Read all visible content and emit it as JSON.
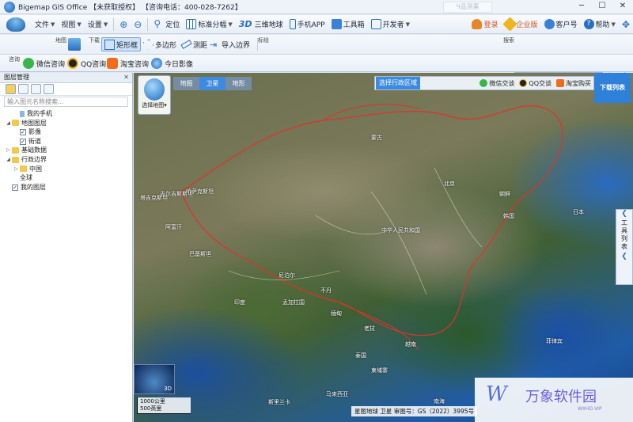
{
  "window": {
    "title": "Bigemap GIS Office 【未获取授权】 【咨询电话：400-028-7262】",
    "ghost_tab": "Ч品测素"
  },
  "menu": {
    "file": "文件",
    "view": "视图",
    "settings": "设置",
    "locate": "定位",
    "standard_split": "标准分幅",
    "three_d_label": "3D",
    "three_d_earth": "三维地球",
    "mobile_app": "手机APP",
    "toolbox": "工具箱",
    "developer": "开发者",
    "login": "登录",
    "enterprise": "企业版",
    "customer_id": "客户号",
    "help": "帮助"
  },
  "toolbar": {
    "map_label": "地图",
    "download_label": "下载",
    "rect_select": "矩形框",
    "polygon": "多边形",
    "measure": "测距",
    "import_border": "导入边界",
    "mark_label": "标绘",
    "search_label": "搜索",
    "consult_label": "咨询",
    "wechat_consult": "微信咨询",
    "qq_consult": "QQ咨询",
    "taobao_consult": "淘宝咨询",
    "today_image": "今日影像"
  },
  "sidebar": {
    "header": "图层管理",
    "close": "✕",
    "search_placeholder": "输入图元名称搜索...",
    "tree": [
      {
        "label": "我的手机",
        "level": 1,
        "type": "file"
      },
      {
        "label": "地图图层",
        "level": 0,
        "type": "folder",
        "expanded": true
      },
      {
        "label": "影像",
        "level": 1,
        "type": "check",
        "checked": true
      },
      {
        "label": "街道",
        "level": 1,
        "type": "check",
        "checked": true
      },
      {
        "label": "基础数据",
        "level": 0,
        "type": "folder",
        "expanded": false
      },
      {
        "label": "行政边界",
        "level": 0,
        "type": "folder",
        "expanded": true
      },
      {
        "label": "中国",
        "level": 1,
        "type": "folder",
        "expanded": false
      },
      {
        "label": "全球",
        "level": 1,
        "type": "plain"
      },
      {
        "label": "我的图层",
        "level": 0,
        "type": "check",
        "checked": true
      }
    ]
  },
  "map": {
    "tabs": [
      "地图",
      "卫星",
      "地形"
    ],
    "active_tab": "卫星",
    "select_region": "选择行政区域",
    "wechat_trade": "微信交谈",
    "qq_trade": "QQ交谈",
    "taobao_buy": "淘宝购买",
    "download_list": "下载列表",
    "choose_map": "选择地图",
    "tool_list": "工具列表",
    "minimap_label": "3D",
    "scale_km": "1000公里",
    "scale_mi": "500英里",
    "footer_info": "星图地球 卫星  审图号：GS（2022）3995号",
    "places": [
      {
        "name": "蒙古"
      },
      {
        "name": "中华人民共和国"
      },
      {
        "name": "北京"
      },
      {
        "name": "朝鲜"
      },
      {
        "name": "韩国"
      },
      {
        "name": "日本"
      },
      {
        "name": "印度"
      },
      {
        "name": "尼泊尔"
      },
      {
        "name": "缅甸"
      },
      {
        "name": "泰国"
      },
      {
        "name": "老挝"
      },
      {
        "name": "越南"
      },
      {
        "name": "菲律宾"
      },
      {
        "name": "巴基斯坦"
      },
      {
        "name": "阿富汗"
      },
      {
        "name": "哈萨克斯坦"
      },
      {
        "name": "吉尔吉斯斯坦"
      },
      {
        "name": "塔吉克斯坦"
      },
      {
        "name": "孟加拉国"
      },
      {
        "name": "不丹"
      },
      {
        "name": "斯里兰卡"
      },
      {
        "name": "马来西亚"
      },
      {
        "name": "柬埔寨"
      },
      {
        "name": "南海"
      }
    ]
  },
  "watermark": {
    "logo": "W",
    "brand": "万象软件园",
    "url": "WXHD.VIP"
  },
  "colors": {
    "accent": "#2f80d8",
    "border_red": "#e0312a"
  }
}
